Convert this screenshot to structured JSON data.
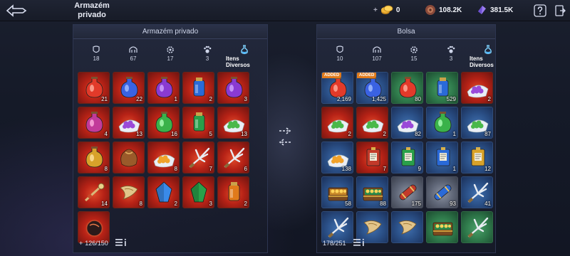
{
  "header": {
    "title": "Armazém privado",
    "currencies": [
      {
        "name": "gold-coin-icon",
        "value": "0",
        "prefix": "+"
      },
      {
        "name": "leather-bag-icon",
        "value": "108.2K"
      },
      {
        "name": "crystal-icon",
        "value": "381.5K"
      }
    ]
  },
  "left": {
    "title": "Armazém privado",
    "tabs": [
      {
        "icon": "armor-icon",
        "count": "18"
      },
      {
        "icon": "helmet-icon",
        "count": "67"
      },
      {
        "icon": "gear-icon",
        "count": "17"
      },
      {
        "icon": "paw-icon",
        "count": "3"
      },
      {
        "icon": "potion-icon",
        "label": "Itens Diversos",
        "active": true
      }
    ],
    "capacity": "126/150",
    "capacity_prefix": "+",
    "items": [
      {
        "item": "red-potion",
        "qty": "21",
        "color": "red"
      },
      {
        "item": "blue-potion",
        "qty": "22",
        "color": "red"
      },
      {
        "item": "purple-potion",
        "qty": "1",
        "color": "red"
      },
      {
        "item": "blue-bottle",
        "qty": "2",
        "color": "red"
      },
      {
        "item": "purple-potion",
        "qty": "3",
        "color": "red"
      },
      {
        "item": "pink-potion",
        "qty": "4",
        "color": "red"
      },
      {
        "item": "purple-orbs",
        "qty": "13",
        "color": "red"
      },
      {
        "item": "green-potion",
        "qty": "16",
        "color": "red"
      },
      {
        "item": "green-bottle",
        "qty": "5",
        "color": "red"
      },
      {
        "item": "green-orbs",
        "qty": "13",
        "color": "red"
      },
      {
        "item": "gold-potion",
        "qty": "8",
        "color": "red"
      },
      {
        "item": "brown-pouch",
        "qty": "",
        "color": "red"
      },
      {
        "item": "gold-orbs",
        "qty": "8",
        "color": "red"
      },
      {
        "item": "claw-weapon",
        "qty": "7",
        "color": "red"
      },
      {
        "item": "claw-weapon",
        "qty": "6",
        "color": "red"
      },
      {
        "item": "ornate-staff",
        "qty": "14",
        "color": "red"
      },
      {
        "item": "golden-horn",
        "qty": "8",
        "color": "red"
      },
      {
        "item": "blue-crystal",
        "qty": "2",
        "color": "red"
      },
      {
        "item": "green-crystal",
        "qty": "3",
        "color": "red"
      },
      {
        "item": "orange-bottle",
        "qty": "2",
        "color": "red"
      },
      {
        "item": "dark-orb",
        "qty": "",
        "color": "red"
      }
    ]
  },
  "right": {
    "title": "Bolsa",
    "tabs": [
      {
        "icon": "armor-icon",
        "count": "10"
      },
      {
        "icon": "helmet-icon",
        "count": "107"
      },
      {
        "icon": "gear-icon",
        "count": "15"
      },
      {
        "icon": "paw-icon",
        "count": "3"
      },
      {
        "icon": "potion-icon",
        "label": "Itens Diversos",
        "active": true
      }
    ],
    "capacity": "178/251",
    "items": [
      {
        "item": "red-potion",
        "qty": "2,169",
        "color": "blue",
        "badge": "ADDED"
      },
      {
        "item": "blue-potion",
        "qty": "1,425",
        "color": "blue",
        "badge": "ADDED"
      },
      {
        "item": "red-potion",
        "qty": "80",
        "color": "green"
      },
      {
        "item": "blue-bottle",
        "qty": "529",
        "color": "green"
      },
      {
        "item": "purple-orbs",
        "qty": "2",
        "color": "red"
      },
      {
        "item": "green-orbs",
        "qty": "2",
        "color": "red"
      },
      {
        "item": "green-orbs",
        "qty": "2",
        "color": "red"
      },
      {
        "item": "purple-orbs",
        "qty": "82",
        "color": "blue"
      },
      {
        "item": "green-potion",
        "qty": "1",
        "color": "blue"
      },
      {
        "item": "green-orbs",
        "qty": "87",
        "color": "blue"
      },
      {
        "item": "gold-orbs",
        "qty": "138",
        "color": "blue"
      },
      {
        "item": "red-scroll",
        "qty": "7",
        "color": "red"
      },
      {
        "item": "green-scroll",
        "qty": "9",
        "color": "blue"
      },
      {
        "item": "blue-scroll",
        "qty": "1",
        "color": "blue"
      },
      {
        "item": "gold-scroll",
        "qty": "12",
        "color": "blue"
      },
      {
        "item": "gold-chest",
        "qty": "58",
        "color": "blue"
      },
      {
        "item": "green-chest",
        "qty": "88",
        "color": "blue"
      },
      {
        "item": "red-scroll-roll",
        "qty": "175",
        "color": "gray"
      },
      {
        "item": "blue-scroll-roll",
        "qty": "93",
        "color": "gray"
      },
      {
        "item": "claw-weapon",
        "qty": "41",
        "color": "blue"
      },
      {
        "item": "claw-weapon",
        "qty": "",
        "color": "blue"
      },
      {
        "item": "golden-horn",
        "qty": "",
        "color": "blue"
      },
      {
        "item": "golden-horn",
        "qty": "",
        "color": "blue"
      },
      {
        "item": "green-chest",
        "qty": "",
        "color": "green"
      },
      {
        "item": "claw-weapon",
        "qty": "",
        "color": "green"
      }
    ]
  }
}
